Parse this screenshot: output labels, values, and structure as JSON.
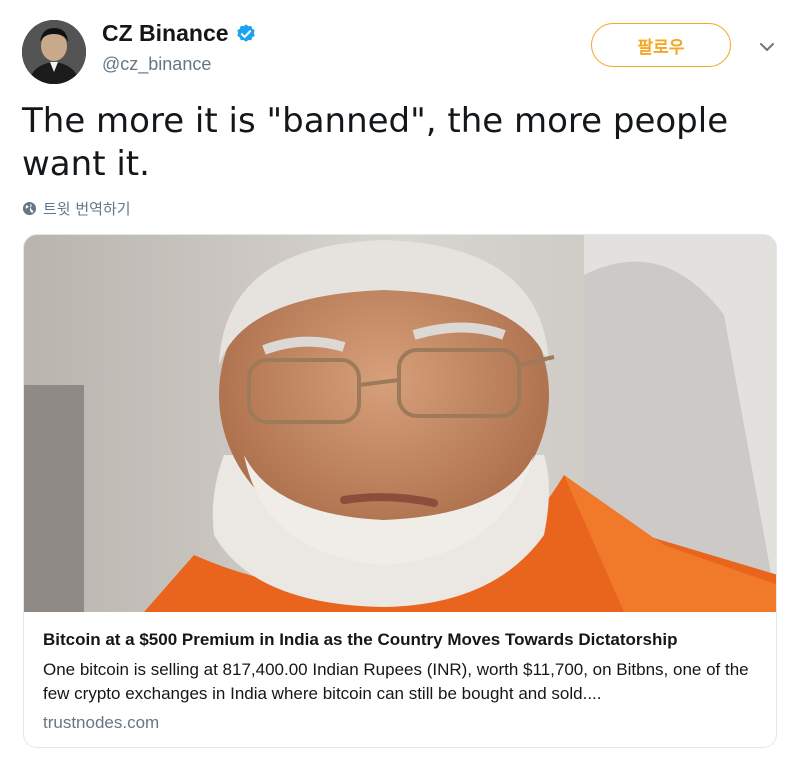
{
  "author": {
    "name": "CZ Binance",
    "handle": "@cz_binance",
    "verified": true,
    "avatar_icon": "user-avatar-photo"
  },
  "follow_button": {
    "label": "팔로우",
    "color": "#f5a623"
  },
  "menu": {
    "icon": "chevron-down-icon"
  },
  "tweet": {
    "text_line1": "The more it is \"banned\", the more people",
    "text_line2": "want it."
  },
  "translate": {
    "label": "트윗 번역하기",
    "icon": "globe-icon"
  },
  "card": {
    "image_icon": "portrait-photo",
    "title": "Bitcoin at a $500 Premium in India as the Country Moves Towards Dictatorship",
    "description": "One bitcoin is selling at 817,400.00 Indian Rupees (INR), worth $11,700, on Bitbns, one of the few crypto exchanges in India where bitcoin can still be bought and sold....",
    "domain": "trustnodes.com"
  },
  "colors": {
    "verified": "#1da1f2",
    "secondary_text": "#657786",
    "border": "#e1e8ed"
  }
}
